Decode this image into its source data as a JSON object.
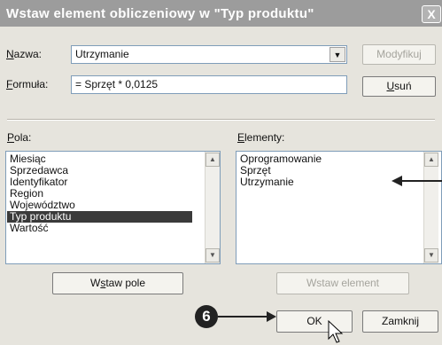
{
  "dialog": {
    "title": "Wstaw element obliczeniowy w \"Typ produktu\"",
    "close_glyph": "X"
  },
  "name_field": {
    "label_u": "N",
    "label_rest": "azwa:",
    "value": "Utrzymanie",
    "arrow": "▼"
  },
  "formula_field": {
    "label_u": "F",
    "label_rest": "ormuła:",
    "value": "= Sprzęt * 0,0125"
  },
  "buttons": {
    "modify": "Modyfikuj",
    "delete_u": "U",
    "delete_rest": "suń",
    "insert_field_pre": "W",
    "insert_field_u": "s",
    "insert_field_rest": "taw pole",
    "insert_item": "Wstaw element",
    "ok": "OK",
    "close": "Zamknij"
  },
  "fields_list": {
    "label_u": "P",
    "label_rest": "ola:",
    "items": [
      "Miesiąc",
      "Sprzedawca",
      "Identyfikator",
      "Region",
      "Województwo",
      "Typ produktu",
      "Wartość"
    ],
    "selected_index": 5
  },
  "items_list": {
    "label_u": "E",
    "label_rest": "lementy:",
    "items": [
      "Oprogramowanie",
      "Sprzęt",
      "Utrzymanie"
    ]
  },
  "callout": {
    "number": "6"
  },
  "colors": {
    "title_bar": "#9c9c9c",
    "dialog_bg": "#e6e4dd",
    "selection": "#3a3a3a",
    "annotation": "#222222"
  }
}
